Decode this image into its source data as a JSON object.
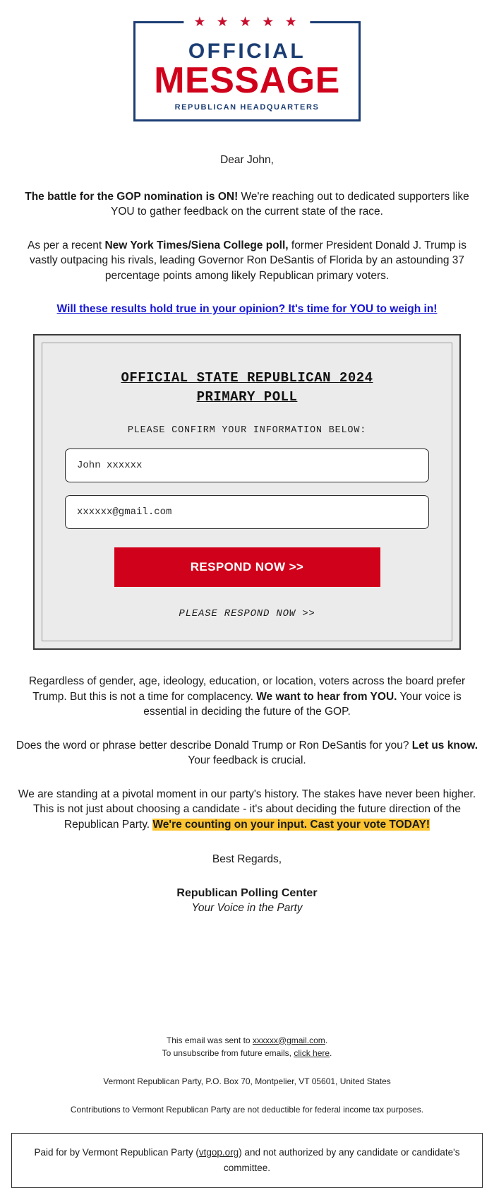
{
  "logo": {
    "stars": "★ ★ ★ ★ ★",
    "line1": "OFFICIAL",
    "line2": "MESSAGE",
    "line3": "REPUBLICAN HEADQUARTERS",
    "blue": "#1b3d73",
    "red": "#d0021b"
  },
  "letter": {
    "greeting": "Dear John,",
    "intro_bold": "The battle for the GOP nomination is ON!",
    "intro_rest": " We're reaching out to dedicated supporters like YOU to gather feedback on the current state of the race.",
    "poll_pre": "As per a recent ",
    "poll_bold": "New York Times/Siena College poll,",
    "poll_rest": " former President Donald J. Trump is vastly outpacing his rivals, leading Governor Ron DeSantis of Florida by an astounding 37 percentage points among likely Republican primary voters.",
    "cta_link": "Will these results hold true in your opinion? It's time for YOU to weigh in!",
    "cta_link_color": "#1414d6"
  },
  "poll_card": {
    "title_line1": "OFFICIAL STATE REPUBLICAN 2024",
    "title_line2": "PRIMARY POLL",
    "subtitle": "PLEASE CONFIRM YOUR INFORMATION BELOW:",
    "name_value": "John xxxxxx",
    "name_placeholder": "John xxxxxx",
    "email_value": "xxxxxx@gmail.com",
    "email_placeholder": "xxxxxx@gmail.com",
    "button_label": "RESPOND NOW >>",
    "button_color": "#d0021b",
    "footer_note": "PLEASE RESPOND NOW >>",
    "card_bg": "#ebebeb"
  },
  "closing": {
    "para1_a": "Regardless of gender, age, ideology, education, or location, voters across the board prefer Trump. But this is not a time for complacency. ",
    "para1_bold": "We want to hear from YOU.",
    "para1_b": " Your voice is essential in deciding the future of the GOP.",
    "para2_a": "Does the word or phrase better describe Donald Trump or Ron DeSantis for you? ",
    "para2_bold": "Let us know.",
    "para2_b": " Your feedback is crucial.",
    "para3_a": "We are standing at a pivotal moment in our party's history. The stakes have never been higher. This is not just about choosing a candidate - it's about deciding the future direction of the Republican Party. ",
    "para3_highlight": "We're counting on your input. Cast your vote TODAY!",
    "highlight_color": "#fdc431",
    "regards": "Best Regards,",
    "signature_name": "Republican Polling Center",
    "signature_tagline": "Your Voice in the Party"
  },
  "footer": {
    "sent_pre": "This email was sent to ",
    "sent_email": "xxxxxx@gmail.com",
    "sent_post": ".",
    "unsub_pre": "To unsubscribe from future emails, ",
    "unsub_link": "click here",
    "unsub_post": ".",
    "address": "Vermont Republican Party, P.O. Box 70, Montpelier, VT 05601, United States",
    "contributions": "Contributions to Vermont Republican Party are not deductible for federal income tax purposes.",
    "disclaimer_pre": "Paid for by Vermont Republican Party (",
    "disclaimer_link": "vtgop.org",
    "disclaimer_post": ") and not authorized by any candidate or candidate's committee."
  }
}
